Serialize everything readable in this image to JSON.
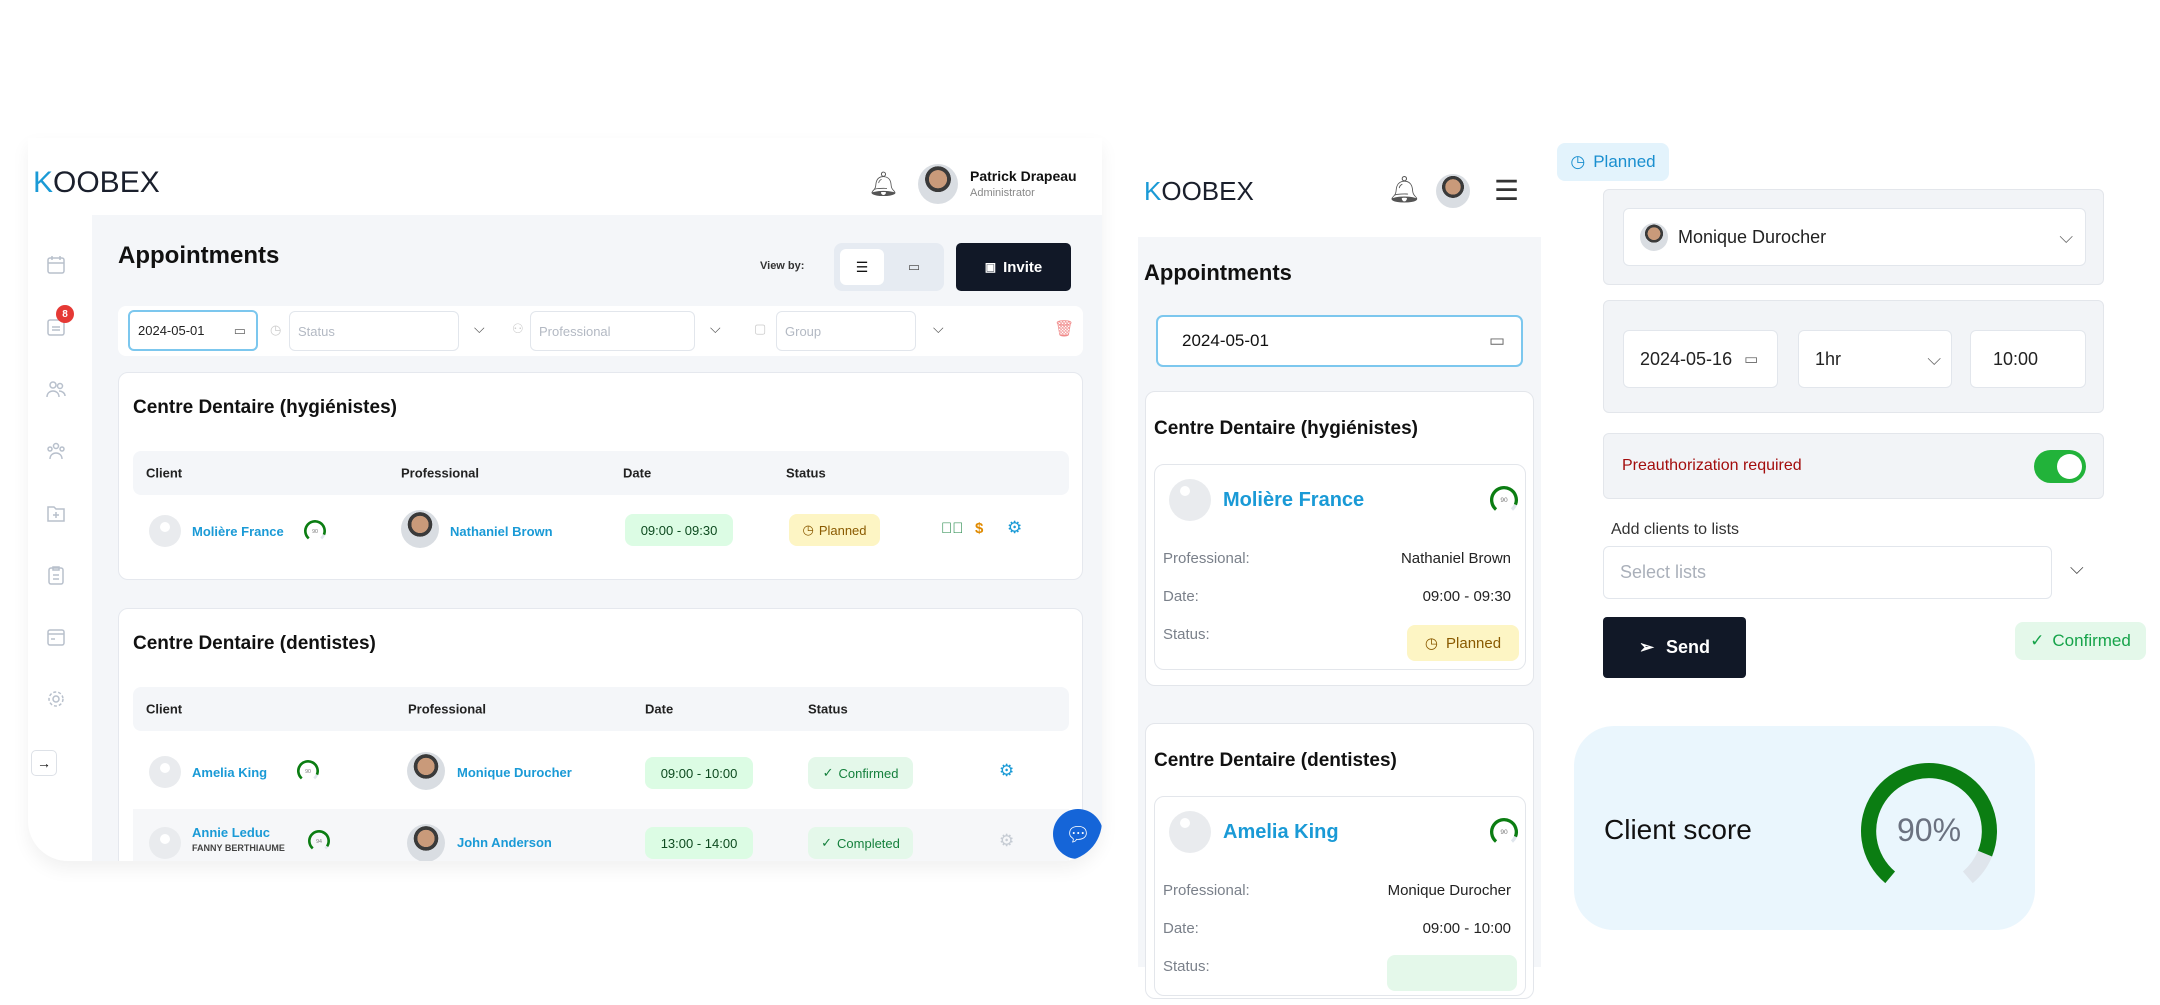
{
  "brand": {
    "logo_text": "KOOBEX",
    "accent": "#1a9ad6"
  },
  "desktop": {
    "user": {
      "name": "Patrick Drapeau",
      "role": "Administrator"
    },
    "sidebar": {
      "badge": "8",
      "icons": [
        "calendar-icon",
        "calendar-list-icon",
        "users-icon",
        "group-icon",
        "folder-add-icon",
        "clipboard-icon",
        "card-icon",
        "gear-icon"
      ]
    },
    "title": "Appointments",
    "view_by_label": "View by:",
    "invite_label": "Invite",
    "filters": {
      "date": "2024-05-01",
      "status_placeholder": "Status",
      "professional_placeholder": "Professional",
      "group_placeholder": "Group"
    },
    "columns": [
      "Client",
      "Professional",
      "Date",
      "Status"
    ],
    "groups": [
      {
        "title": "Centre Dentaire (hygiénistes)",
        "rows": [
          {
            "client": "Molière France",
            "score": 90,
            "professional": "Nathaniel Brown",
            "time": "09:00 - 09:30",
            "status": "Planned"
          }
        ]
      },
      {
        "title": "Centre Dentaire (dentistes)",
        "rows": [
          {
            "client": "Amelia King",
            "score": 90,
            "professional": "Monique Durocher",
            "time": "09:00 - 10:00",
            "status": "Confirmed"
          },
          {
            "client": "Annie Leduc",
            "sub": "FANNY BERTHIAUME",
            "score": 94,
            "professional": "John Anderson",
            "time": "13:00 - 14:00",
            "status": "Completed"
          }
        ]
      }
    ]
  },
  "mobile": {
    "title": "Appointments",
    "date": "2024-05-01",
    "labels": {
      "professional": "Professional:",
      "date": "Date:",
      "status": "Status:"
    },
    "groups": [
      {
        "title": "Centre Dentaire (hygiénistes)",
        "client": "Molière France",
        "score": 90,
        "professional": "Nathaniel Brown",
        "time": "09:00 - 09:30",
        "status": "Planned"
      },
      {
        "title": "Centre Dentaire (dentistes)",
        "client": "Amelia King",
        "score": 90,
        "professional": "Monique Durocher",
        "time": "09:00 - 10:00"
      }
    ]
  },
  "form": {
    "planned_chip": "Planned",
    "professional": "Monique Durocher",
    "date": "2024-05-16",
    "duration": "1hr",
    "time": "10:00",
    "preauth_label": "Preauthorization required",
    "preauth_on": true,
    "lists_label": "Add clients to lists",
    "lists_placeholder": "Select lists",
    "send_label": "Send",
    "confirmed_chip": "Confirmed",
    "score_label": "Client score",
    "score_value": "90%",
    "score": 90
  },
  "colors": {
    "gauge_green": "#0b7d12",
    "gauge_track": "#dfe5ec",
    "dark_button": "#111827",
    "toggle_green": "#22b33a",
    "preauth_red": "#a30d0d"
  }
}
